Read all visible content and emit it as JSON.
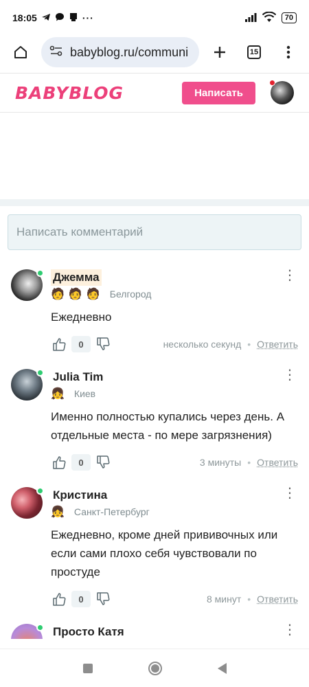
{
  "status_bar": {
    "time": "18:05",
    "icons_left": [
      "telegram-icon",
      "chat-bubble-icon",
      "notification-icon",
      "more-icon"
    ],
    "icons_right": [
      "signal-icon",
      "wifi-icon",
      "battery-icon"
    ],
    "battery": "70"
  },
  "browser": {
    "url": "babyblog.ru/communi",
    "tabs_count": "15"
  },
  "header": {
    "logo": "BABYBLOG",
    "write_button": "Написать"
  },
  "comment_box": {
    "placeholder": "Написать комментарий"
  },
  "comments": [
    {
      "name": "Джемма",
      "badges": [
        "🧑",
        "🧑",
        "🧑"
      ],
      "city": "Белгород",
      "text": "Ежедневно",
      "votes": "0",
      "time": "несколько секунд",
      "reply": "Ответить"
    },
    {
      "name": "Julia Tim",
      "badges": [
        "👧"
      ],
      "city": "Киев",
      "text": "Именно полностью купались через день. А отдельные места - по мере загрязнения)",
      "votes": "0",
      "time": "3 минуты",
      "reply": "Ответить"
    },
    {
      "name": "Кристина",
      "badges": [
        "👧"
      ],
      "city": "Санкт-Петербург",
      "text": "Ежедневно, кроме дней прививочных или если сами плохо себя чувствовали по простуде",
      "votes": "0",
      "time": "8 минут",
      "reply": "Ответить"
    },
    {
      "name": "Просто Катя"
    }
  ]
}
